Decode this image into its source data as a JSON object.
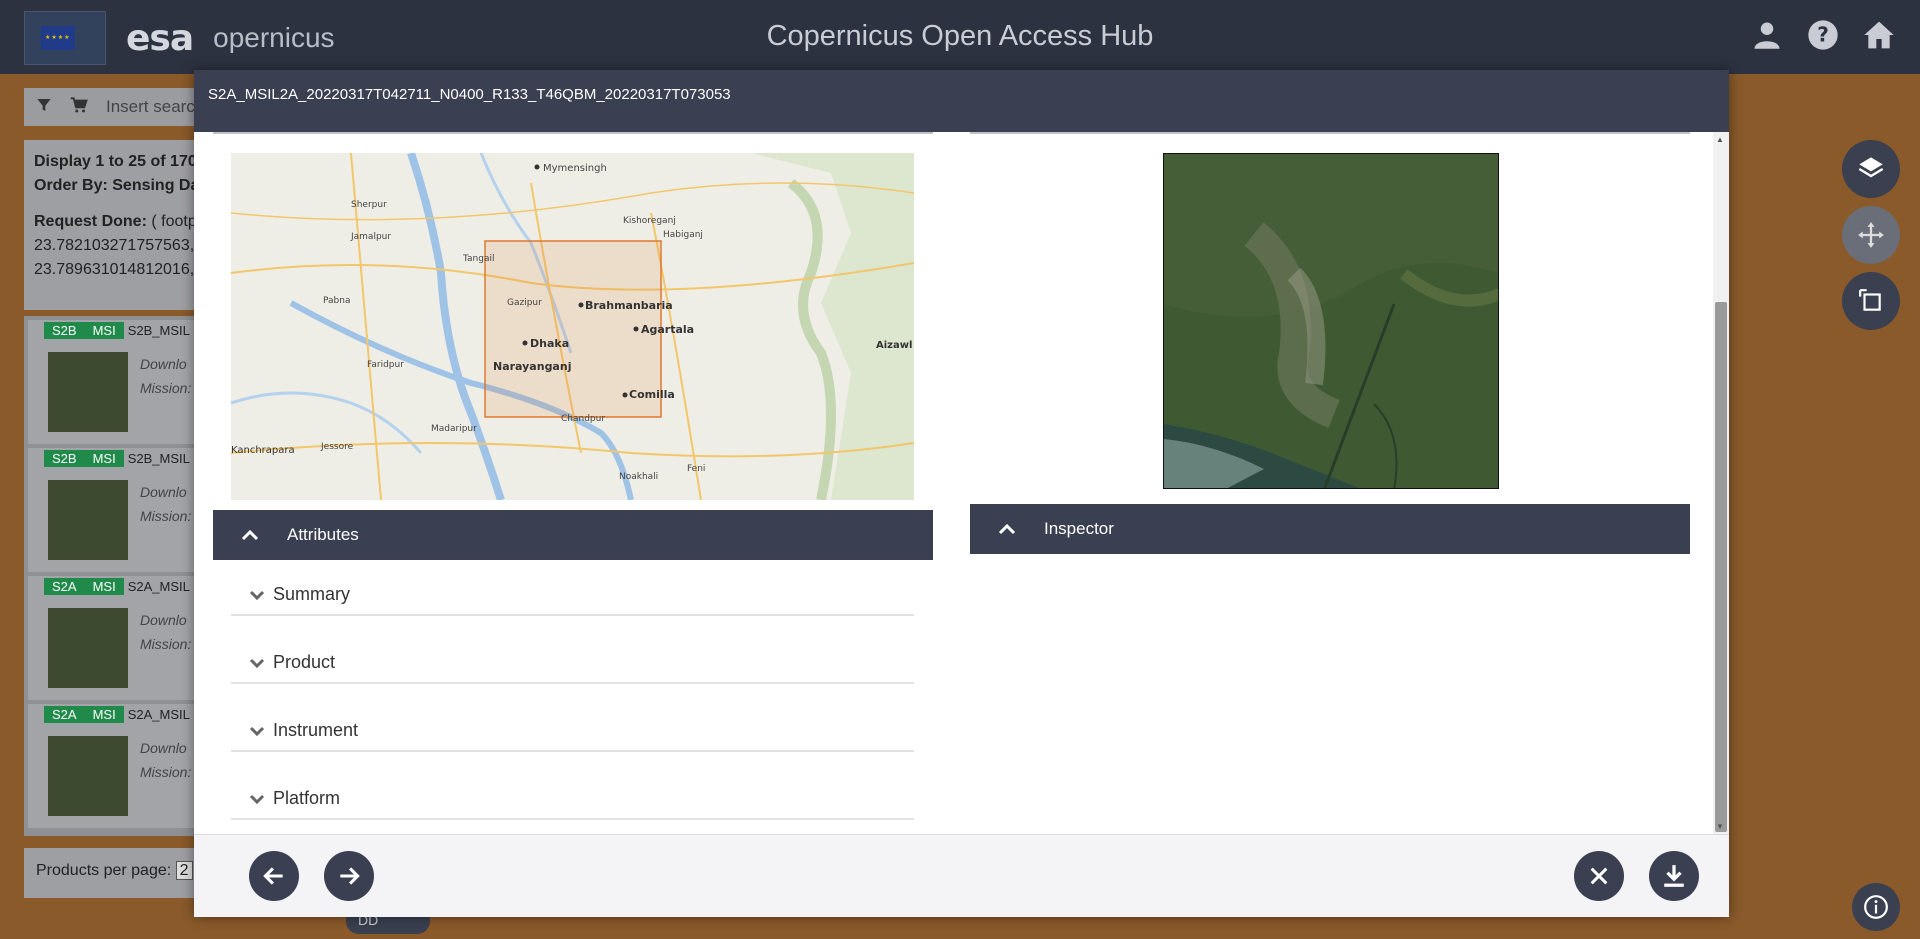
{
  "header": {
    "title": "Copernicus Open Access Hub",
    "esa_logo": "esa",
    "copernicus_logo": "opernicus",
    "icons": [
      "user-icon",
      "help-icon",
      "home-icon"
    ]
  },
  "background": {
    "search_placeholder": "Insert search",
    "display_text": "Display 1 to 25 of 170",
    "order_by": "Order By: Sensing Dat",
    "request_done_label": "Request Done:",
    "request_done_value": "( footp",
    "coords": [
      "23.782103271757563,",
      "23.789631014812016,"
    ],
    "items": [
      {
        "tags": [
          "S2B",
          "MSI"
        ],
        "name": "S2B_MSIL",
        "line1": "Downlo",
        "line2": "Mission:"
      },
      {
        "tags": [
          "S2B",
          "MSI"
        ],
        "name": "S2B_MSIL",
        "line1": "Downlo",
        "line2": "Mission:"
      },
      {
        "tags": [
          "S2A",
          "MSI"
        ],
        "name": "S2A_MSIL",
        "line1": "Downlo",
        "line2": "Mission:"
      },
      {
        "tags": [
          "S2A",
          "MSI"
        ],
        "name": "S2A_MSIL",
        "line1": "Downlo",
        "line2": "Mission:"
      }
    ],
    "products_per_page": "Products per page:",
    "products_per_page_value": "2",
    "dd_label": "DD"
  },
  "modal": {
    "product_title": "S2A_MSIL2A_20220317T042711_N0400_R133_T46QBM_20220317T073053",
    "attributes_label": "Attributes",
    "inspector_label": "Inspector",
    "sections": [
      "Summary",
      "Product",
      "Instrument",
      "Platform"
    ],
    "map_labels": {
      "dhaka": "Dhaka",
      "narayanganj": "Narayanganj",
      "brahmanbaria": "Brahmanbaria",
      "agartala": "Agartala",
      "comilla": "Comilla",
      "mymensingh": "Mymensingh",
      "aizawl": "Aizawl",
      "kanchrapara": "Kanchrapara",
      "gazipur": "Gazipur",
      "tangail": "Tangail",
      "kishoreganj": "Kishoreganj",
      "habiganj": "Habiganj",
      "sherpur": "Sherpur",
      "jamalpur": "Jamalpur",
      "pabna": "Pabna",
      "faridpur": "Faridpur",
      "jessore": "Jessore",
      "madaripur": "Madaripur",
      "chandpur": "Chandpur",
      "feni": "Feni",
      "noakhali": "Noakhali"
    }
  },
  "colors": {
    "header_bg": "#2d3240",
    "modal_header_bg": "#3a3f52",
    "tag_green": "#1f8a4a",
    "footprint": "#e07a2e"
  }
}
